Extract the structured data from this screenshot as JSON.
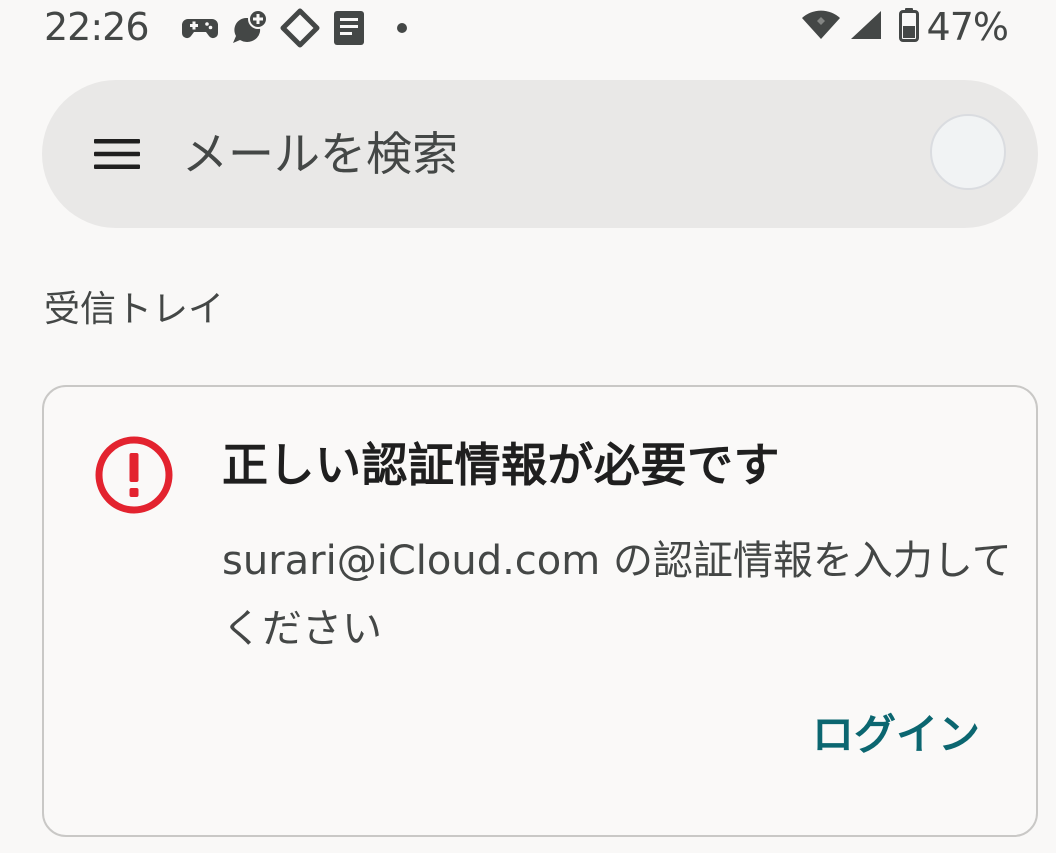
{
  "status_bar": {
    "time": "22:26",
    "battery_percent": "47%",
    "notification_icons": [
      "game-controller-icon",
      "chat-plus-icon",
      "diamond-icon",
      "document-icon",
      "more-dot-icon"
    ]
  },
  "search": {
    "placeholder": "メールを検索"
  },
  "section": {
    "label": "受信トレイ"
  },
  "alert": {
    "title": "正しい認証情報が必要です",
    "message": "surari@iCloud.com の認証情報を入力してください",
    "action_label": "ログイン"
  },
  "colors": {
    "error": "#e3232f",
    "accent": "#0b6670",
    "background": "#f9f8f7",
    "search_bar": "#e9e8e7"
  }
}
